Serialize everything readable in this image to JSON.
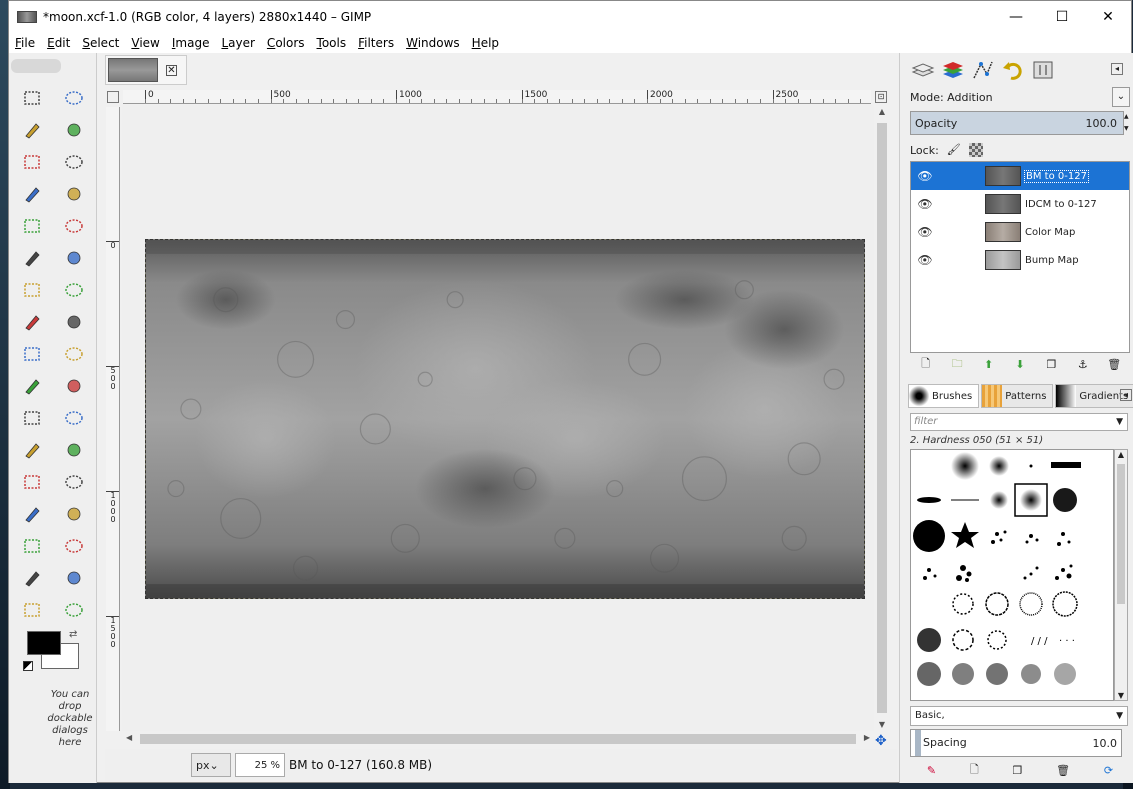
{
  "window": {
    "title": "*moon.xcf-1.0 (RGB color, 4 layers) 2880x1440 – GIMP",
    "minimize": "—",
    "maximize": "☐",
    "close": "✕"
  },
  "menu": [
    {
      "key": "F",
      "rest": "ile"
    },
    {
      "key": "E",
      "rest": "dit"
    },
    {
      "key": "S",
      "rest": "elect"
    },
    {
      "key": "V",
      "rest": "iew"
    },
    {
      "key": "I",
      "rest": "mage"
    },
    {
      "key": "L",
      "rest": "ayer"
    },
    {
      "key": "C",
      "rest": "olors"
    },
    {
      "key": "T",
      "rest": "ools"
    },
    {
      "key": "F",
      "rest": "ilters"
    },
    {
      "key": "W",
      "rest": "indows"
    },
    {
      "key": "H",
      "rest": "elp"
    }
  ],
  "toolbox": {
    "tools": [
      "rect-select",
      "ellipse-select",
      "free-select",
      "fuzzy-select",
      "select-by-color",
      "scissors-select",
      "foreground-select",
      "paths",
      "color-picker",
      "zoom",
      "measure",
      "move",
      "align",
      "crop",
      "rotate",
      "scale",
      "shear",
      "perspective",
      "flip",
      "cage-transform",
      "text",
      "bucket-fill",
      "blend",
      "pencil",
      "paintbrush",
      "eraser",
      "airbrush",
      "ink",
      "clone",
      "heal",
      "perspective-clone",
      "smudge",
      "dodge-burn",
      "convolve"
    ],
    "drop_note": "You can drop dockable dialogs here",
    "fg_color": "#000000",
    "bg_color": "#ffffff"
  },
  "image_tab": {
    "close": "✕"
  },
  "ruler_h": [
    "0",
    "500",
    "1000",
    "1500",
    "2000",
    "2500"
  ],
  "ruler_v": [
    "0",
    "5\n0\n0",
    "1\n0\n0\n0",
    "1\n5\n0\n0"
  ],
  "status": {
    "unit": "px",
    "zoom": "25 %",
    "text": "BM to 0-127 (160.8 MB)"
  },
  "layers_panel": {
    "mode": "Mode: Addition",
    "opacity_label": "Opacity",
    "opacity_value": "100.0",
    "lock_label": "Lock:",
    "layers": [
      {
        "name": "BM to 0-127",
        "selected": true,
        "visible": true
      },
      {
        "name": "IDCM to 0-127",
        "selected": false,
        "visible": true
      },
      {
        "name": "Color Map",
        "selected": false,
        "visible": true
      },
      {
        "name": "Bump Map",
        "selected": false,
        "visible": true
      }
    ]
  },
  "brushes_panel": {
    "tabs": [
      "Brushes",
      "Patterns",
      "Gradients"
    ],
    "filter_placeholder": "filter",
    "current_brush": "2. Hardness 050 (51 × 51)",
    "preset": "Basic,",
    "spacing_label": "Spacing",
    "spacing_value": "10.0"
  }
}
